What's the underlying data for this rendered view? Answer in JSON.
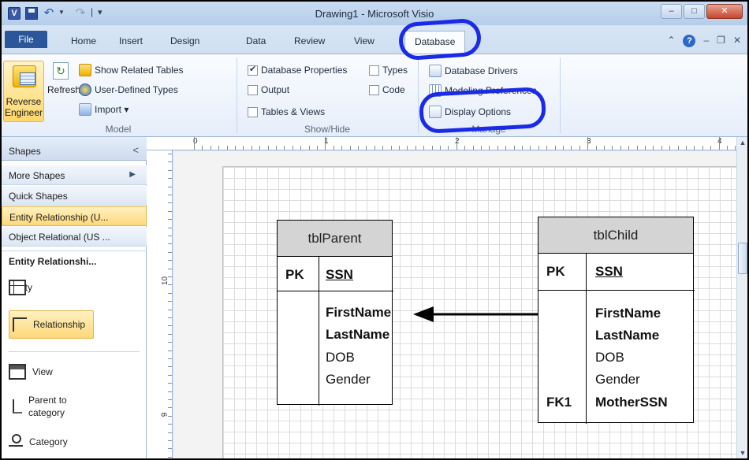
{
  "window": {
    "title": "Drawing1 - Microsoft Visio",
    "minimize": "–",
    "maximize": "□",
    "close": "✕"
  },
  "quick_access": {
    "app_letter": "V",
    "separator": "|",
    "customize": "▾"
  },
  "ribbon": {
    "file_tab": "File",
    "tabs": [
      "Home",
      "Insert",
      "Design",
      "Data",
      "Review",
      "View",
      "Database"
    ],
    "active_tab": "Database",
    "right_controls": [
      "⌃",
      "?",
      "–",
      "❐",
      "✕"
    ],
    "groups": {
      "model": {
        "label": "Model",
        "reverse_engineer": "Reverse Engineer",
        "refresh": "Refresh",
        "show_related_tables": "Show Related Tables",
        "user_defined_types": "User-Defined Types",
        "import": "Import ▾"
      },
      "show_hide": {
        "label": "Show/Hide",
        "database_properties": {
          "label": "Database Properties",
          "checked": true
        },
        "types": {
          "label": "Types",
          "checked": false
        },
        "output": {
          "label": "Output",
          "checked": false
        },
        "code": {
          "label": "Code",
          "checked": false
        },
        "tables_views": {
          "label": "Tables & Views",
          "checked": false
        }
      },
      "manage": {
        "label": "Manage",
        "database_drivers": "Database Drivers",
        "modeling_preferences": "Modeling Preferences",
        "display_options": "Display Options"
      }
    }
  },
  "shapes_pane": {
    "title": "Shapes",
    "collapse": "<",
    "stencils": [
      {
        "label": "More Shapes",
        "arrow": "▶"
      },
      {
        "label": "Quick Shapes"
      },
      {
        "label": "Entity Relationship (U..."
      },
      {
        "label": "Object Relational (US ..."
      }
    ],
    "selected_stencil": "Entity Relationship (U...",
    "stencil_title": "Entity Relationshi...",
    "shapes": [
      "Entity",
      "Relationship",
      "View",
      "Parent to category",
      "Category"
    ],
    "selected_shape": "Relationship"
  },
  "rulers": {
    "top": [
      "0",
      "1",
      "2",
      "3",
      "4"
    ],
    "left": [
      "10",
      "9"
    ]
  },
  "diagram": {
    "entities": [
      {
        "name": "tblParent",
        "pk_key": "PK",
        "pk_field": "SSN",
        "fields": [
          {
            "key": "",
            "name": "FirstName",
            "bold": true
          },
          {
            "key": "",
            "name": "LastName",
            "bold": true
          },
          {
            "key": "",
            "name": "DOB",
            "bold": false
          },
          {
            "key": "",
            "name": "Gender",
            "bold": false
          }
        ]
      },
      {
        "name": "tblChild",
        "pk_key": "PK",
        "pk_field": "SSN",
        "fields": [
          {
            "key": "",
            "name": "FirstName",
            "bold": true
          },
          {
            "key": "",
            "name": "LastName",
            "bold": true
          },
          {
            "key": "",
            "name": "DOB",
            "bold": false
          },
          {
            "key": "",
            "name": "Gender",
            "bold": false
          },
          {
            "key": "FK1",
            "name": "MotherSSN",
            "bold": true
          }
        ]
      }
    ],
    "relationship": {
      "from": "tblChild",
      "to": "tblParent"
    }
  },
  "colors": {
    "annotation": "#1a2ae6",
    "file_tab": "#2b579a",
    "selection": "#fdd87a",
    "entity_header": "#d4d4d4"
  }
}
